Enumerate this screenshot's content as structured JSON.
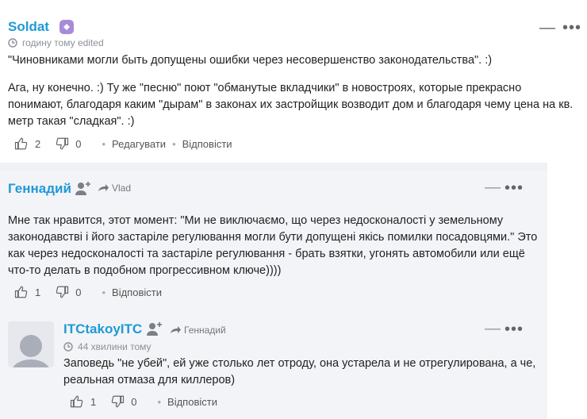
{
  "comments": [
    {
      "author": "Soldat",
      "time": "годину тому edited",
      "paragraphs": [
        "\"Чиновниками могли быть допущены ошибки через несовершенство законодательства\". :)",
        "Ага, ну конечно. :) Ту же \"песню\" поют \"обманутые вкладчики\" в новостроях, которые прекрасно понимают, благодаря каким \"дырам\" в законах их застройщик возводит дом и благодаря чему цена на кв. метр такая \"сладкая\". :)"
      ],
      "likes": "2",
      "dislikes": "0",
      "edit_label": "Редагувати",
      "reply_label": "Відповісти"
    },
    {
      "author": "Геннадий",
      "reply_to": "Vlad",
      "text": "Мне так нравится, этот момент: \"Ми не виключаємо, що через недосконалості у земельному законодавстві і його застаріле регулювання могли бути допущені якісь помилки посадовцями.\" Это как через недосконалості та застаріле регулювання - брать взятки, угонять автомобили или ещё что-то делать в подобном прогрессивном ключе))))",
      "likes": "1",
      "dislikes": "0",
      "reply_label": "Відповісти"
    },
    {
      "author": "ITCtakoyITC",
      "reply_to": "Геннадий",
      "time": "44 хвилини тому",
      "text": "Заповедь \"не убей\", ей уже столько лет отроду, она устарела и не отрегулирована, а че, реальная отмаза для киллеров)",
      "likes": "1",
      "dislikes": "0",
      "reply_label": "Відповісти"
    }
  ],
  "colors": {
    "author": "#1f9ad6",
    "badge": "#a98ad8",
    "reply_bg": "#f3f4f7"
  }
}
